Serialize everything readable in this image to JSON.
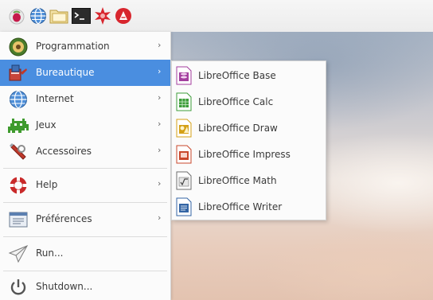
{
  "taskbar": {
    "buttons": [
      {
        "icon": "raspberry-menu-icon"
      },
      {
        "icon": "web-browser-globe-icon"
      },
      {
        "icon": "file-manager-folder-icon"
      },
      {
        "icon": "terminal-icon"
      },
      {
        "icon": "wolfram-star-icon"
      },
      {
        "icon": "mathematica-icon"
      }
    ]
  },
  "menu": {
    "items": [
      {
        "label": "Programmation",
        "icon": "programming-icon",
        "has_submenu": true
      },
      {
        "label": "Bureautique",
        "icon": "office-icon",
        "has_submenu": true,
        "selected": true
      },
      {
        "label": "Internet",
        "icon": "internet-globe-icon",
        "has_submenu": true
      },
      {
        "label": "Jeux",
        "icon": "games-invader-icon",
        "has_submenu": true
      },
      {
        "label": "Accessoires",
        "icon": "accessories-icon",
        "has_submenu": true
      },
      {
        "label": "Help",
        "icon": "help-lifebuoy-icon",
        "has_submenu": true
      },
      {
        "label": "Préférences",
        "icon": "preferences-icon",
        "has_submenu": true
      },
      {
        "label": "Run...",
        "icon": "run-paper-plane-icon",
        "has_submenu": false
      },
      {
        "label": "Shutdown...",
        "icon": "power-icon",
        "has_submenu": false
      }
    ],
    "arrow_glyph": "›",
    "selected_color": "#4a8ee0"
  },
  "submenu": {
    "items": [
      {
        "label": "LibreOffice Base",
        "icon": "libreoffice-base-icon",
        "color": "#a33e9e"
      },
      {
        "label": "LibreOffice Calc",
        "icon": "libreoffice-calc-icon",
        "color": "#3d9c3a"
      },
      {
        "label": "LibreOffice Draw",
        "icon": "libreoffice-draw-icon",
        "color": "#d4a017"
      },
      {
        "label": "LibreOffice Impress",
        "icon": "libreoffice-impress-icon",
        "color": "#c9472b"
      },
      {
        "label": "LibreOffice Math",
        "icon": "libreoffice-math-icon",
        "color": "#6e6e6e"
      },
      {
        "label": "LibreOffice Writer",
        "icon": "libreoffice-writer-icon",
        "color": "#3465a4"
      }
    ]
  }
}
